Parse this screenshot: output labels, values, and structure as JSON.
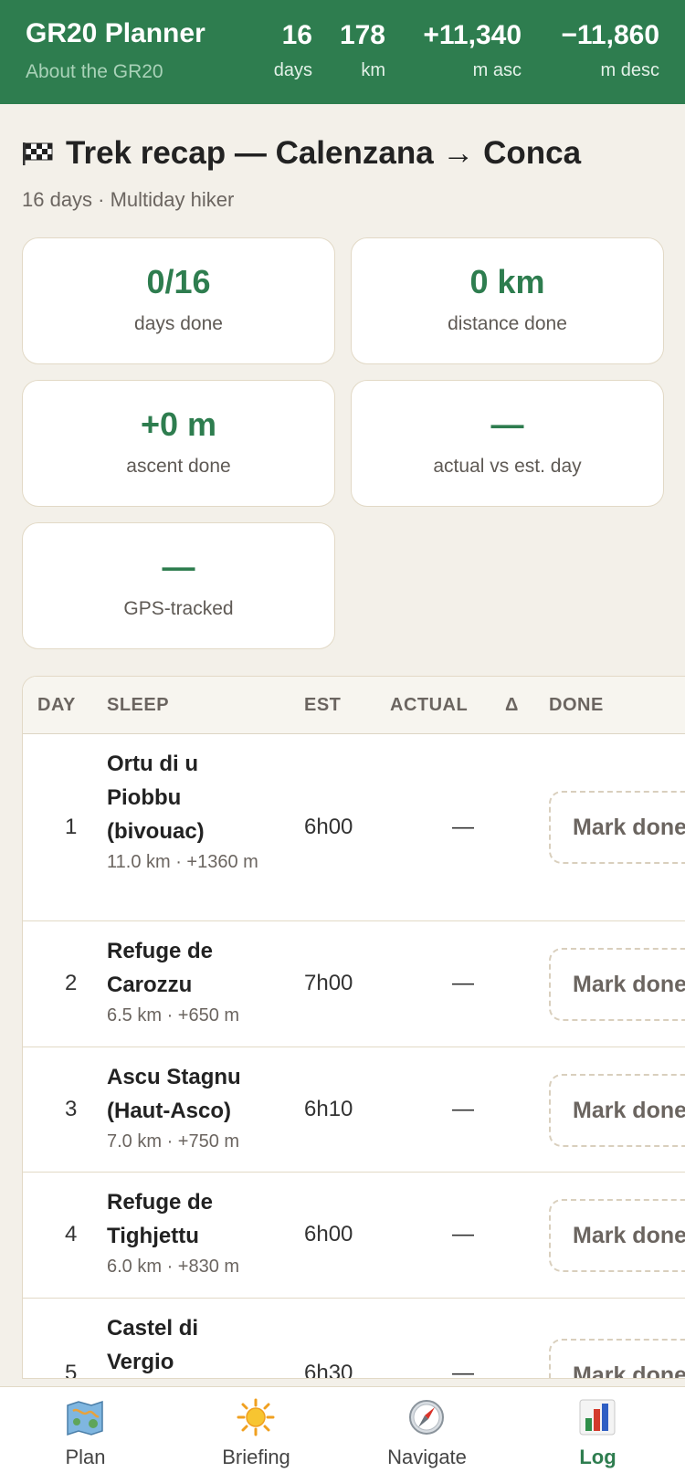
{
  "header": {
    "title": "GR20 Planner",
    "about_link": "About the GR20",
    "stats": [
      {
        "value": "16",
        "label": "days"
      },
      {
        "value": "178",
        "label": "km"
      },
      {
        "value": "+11,340",
        "label": "m asc"
      },
      {
        "value": "−11,860",
        "label": "m desc"
      }
    ]
  },
  "recap": {
    "title": "Trek recap — Calenzana → Conca",
    "subtitle": "16 days · Multiday hiker"
  },
  "cards": [
    {
      "value": "0/16",
      "label": "days done"
    },
    {
      "value": "0 km",
      "label": "distance done"
    },
    {
      "value": "+0 m",
      "label": "ascent done"
    },
    {
      "value": "—",
      "label": "actual vs est. day"
    },
    {
      "value": "—",
      "label": "GPS-tracked"
    }
  ],
  "table": {
    "headers": {
      "day": "DAY",
      "sleep": "SLEEP",
      "est": "EST",
      "actual": "ACTUAL",
      "delta": "Δ",
      "done": "DONE"
    },
    "rows": [
      {
        "day": "1",
        "name": "Ortu di u Piobbu (bivouac)",
        "meta": "11.0 km · +1360 m",
        "est": "6h00",
        "actual": "—",
        "action": "Mark done"
      },
      {
        "day": "2",
        "name": "Refuge de Carozzu",
        "meta": "6.5 km · +650 m",
        "est": "7h00",
        "actual": "—",
        "action": "Mark done"
      },
      {
        "day": "3",
        "name": "Ascu Stagnu (Haut-Asco)",
        "meta": "7.0 km · +750 m",
        "est": "6h10",
        "actual": "—",
        "action": "Mark done"
      },
      {
        "day": "4",
        "name": "Refuge de Tighjettu",
        "meta": "6.0 km · +830 m",
        "est": "6h00",
        "actual": "—",
        "action": "Mark done"
      },
      {
        "day": "5",
        "name": "Castel di Vergio",
        "meta": "",
        "est": "6h30",
        "actual": "—",
        "action": "Mark done"
      }
    ]
  },
  "nav": [
    {
      "label": "Plan",
      "icon": "map-icon"
    },
    {
      "label": "Briefing",
      "icon": "sun-icon"
    },
    {
      "label": "Navigate",
      "icon": "compass-icon"
    },
    {
      "label": "Log",
      "icon": "bar-chart-icon",
      "active": true
    }
  ],
  "colors": {
    "accent": "#2e7d4f",
    "background": "#f3f0e9"
  }
}
